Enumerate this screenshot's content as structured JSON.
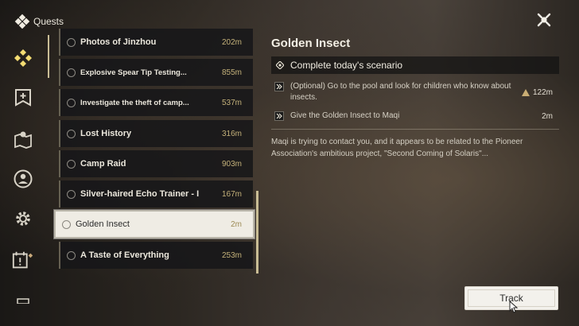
{
  "header": {
    "title": "Quests",
    "icon": "quest-diamond-icon"
  },
  "close": {
    "icon": "close-x-icon"
  },
  "rail": [
    {
      "name": "rail-main-quests",
      "icon": "diamond-cluster-icon",
      "active": true
    },
    {
      "name": "rail-companion-quests",
      "icon": "banner-plus-icon"
    },
    {
      "name": "rail-exploration-quests",
      "icon": "map-pin-icon"
    },
    {
      "name": "rail-character-quests",
      "icon": "person-circle-icon"
    },
    {
      "name": "rail-guidebook-quests",
      "icon": "gear-icon"
    },
    {
      "name": "rail-event-quests",
      "icon": "calendar-icon"
    }
  ],
  "quests": [
    {
      "name": "Photos of Jinzhou",
      "distance": "202m"
    },
    {
      "name": "Explosive Spear Tip Testing...",
      "distance": "855m"
    },
    {
      "name": "Investigate the theft of camp...",
      "distance": "537m"
    },
    {
      "name": "Lost History",
      "distance": "316m"
    },
    {
      "name": "Camp Raid",
      "distance": "903m"
    },
    {
      "name": "Silver-haired Echo Trainer - I",
      "distance": "167m"
    },
    {
      "name": "Golden Insect",
      "distance": "2m",
      "selected": true
    },
    {
      "name": "A Taste of Everything",
      "distance": "253m"
    }
  ],
  "detail": {
    "title": "Golden Insect",
    "stage": "Complete today's scenario",
    "steps": [
      {
        "text": "(Optional) Go to the pool and look for children who know about insects.",
        "distance": "122m",
        "marker": "triangle-warning-icon"
      },
      {
        "text": "Give the Golden Insect to Maqi",
        "distance": "2m"
      }
    ],
    "description": "Maqi is trying to contact you, and it appears to be related to the Pioneer Association's ambitious project, \"Second Coming of Solaris\"..."
  },
  "track_button": {
    "label": "Track"
  },
  "colors": {
    "accent_gold": "#c9bd95",
    "distance_gold": "#c5b27a",
    "selected_bg": "#efece4"
  }
}
